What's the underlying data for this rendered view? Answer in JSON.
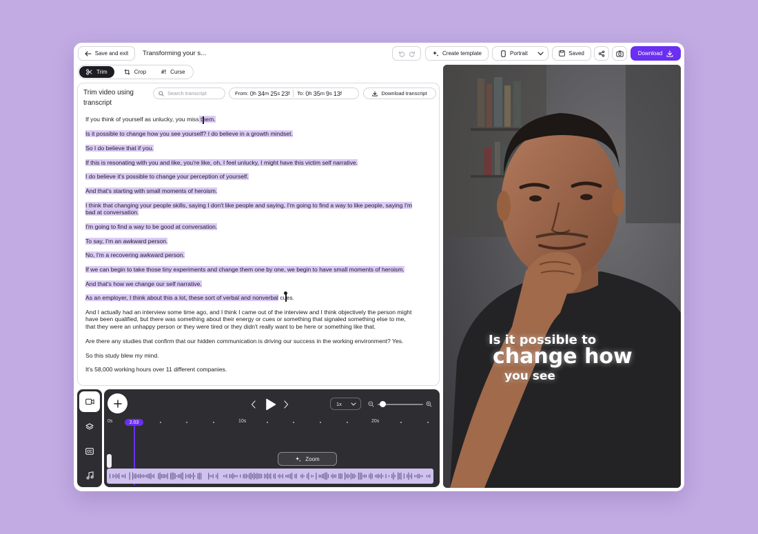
{
  "topbar": {
    "save_exit_label": "Save and exit",
    "project_title": "Transforming your s...",
    "create_template_label": "Create template",
    "orientation_label": "Portrait",
    "saved_label": "Saved",
    "download_label": "Download"
  },
  "tabs": [
    {
      "label": "Trim",
      "icon": "scissors-icon",
      "active": true
    },
    {
      "label": "Crop",
      "icon": "crop-icon",
      "active": false
    },
    {
      "label": "Curse",
      "icon": "hash-exclaim-icon",
      "active": false
    }
  ],
  "transcript": {
    "heading": "Trim video using transcript",
    "search_placeholder": "Search transcript",
    "from_label": "From:",
    "from": {
      "h": "0",
      "m": "34",
      "s": "25",
      "f": "23"
    },
    "to_label": "To:",
    "to": {
      "h": "0",
      "m": "35",
      "s": "9",
      "f": "13"
    },
    "download_label": "Download transcript",
    "lines": [
      {
        "pre": "If you think of yourself as unlucky, you miss",
        "hl": " them.",
        "post": ""
      },
      {
        "pre": "",
        "hl": "Is it possible to change how you see yourself? I do believe in a growth mindset.",
        "post": ""
      },
      {
        "pre": "",
        "hl": "So I do believe that if you.",
        "post": ""
      },
      {
        "pre": "",
        "hl": "If this is resonating with you and like, you're like, oh, I feel unlucky, I might have this victim self narrative.",
        "post": ""
      },
      {
        "pre": "",
        "hl": "I do believe it's possible to change your perception of yourself.",
        "post": ""
      },
      {
        "pre": "",
        "hl": "And that's starting with small moments of heroism.",
        "post": ""
      },
      {
        "pre": "",
        "hl": "I think that changing your people skills, saying I don't like people and saying, I'm going to find a way to like people, saying I'm",
        "post": ""
      },
      {
        "pre": "",
        "hl": "bad at conversation.",
        "post": ""
      },
      {
        "pre": "",
        "hl": "I'm going to find a way to be good at conversation.",
        "post": ""
      },
      {
        "pre": "",
        "hl": "To say, I'm an awkward person.",
        "post": ""
      },
      {
        "pre": "",
        "hl": "No, I'm a recovering awkward person.",
        "post": ""
      },
      {
        "pre": "",
        "hl": "If we can begin to take those tiny experiments and change them one by one, we begin to have small moments of heroism.",
        "post": ""
      },
      {
        "pre": "",
        "hl": "And that's how we change our self narrative.",
        "post": ""
      },
      {
        "pre": "",
        "hl": "As an employer, I think about this a lot, these sort of verbal and nonverbal",
        "post": " cues."
      },
      {
        "pre": "And I actually had an interview some time ago, and I think I came out of the interview and I think objectively the person might",
        "hl": "",
        "post": ""
      },
      {
        "pre": "have been qualified, but there was something about their energy or cues or something that signaled something else to me,",
        "hl": "",
        "post": ""
      },
      {
        "pre": "that they were an unhappy person or they were tired or they didn't really want to be here or something like that.",
        "hl": "",
        "post": ""
      },
      {
        "pre": "Are there any studies that confirm that our hidden communication is driving our success in the working environment? Yes.",
        "hl": "",
        "post": ""
      },
      {
        "pre": "So this study blew my mind.",
        "hl": "",
        "post": ""
      },
      {
        "pre": "It's 58,000 working hours over 11 different companies.",
        "hl": "",
        "post": ""
      }
    ]
  },
  "timeline": {
    "speed": "1x",
    "playhead_time": "2.03",
    "zoom_label": "Zoom",
    "ruler_labels": [
      "0s",
      "10s",
      "20s"
    ],
    "side_tools": [
      "video-icon",
      "layers-icon",
      "captions-icon",
      "music-icon"
    ]
  },
  "video": {
    "caption_line1": "Is it possible to",
    "caption_line2": "change how",
    "caption_line3": "you see"
  },
  "colors": {
    "accent": "#6a2ff0",
    "highlight": "#dccbf7",
    "background": "#c2abe3",
    "timeline_bg": "#2e2e32",
    "waveform_bg": "#cfc2ee"
  }
}
